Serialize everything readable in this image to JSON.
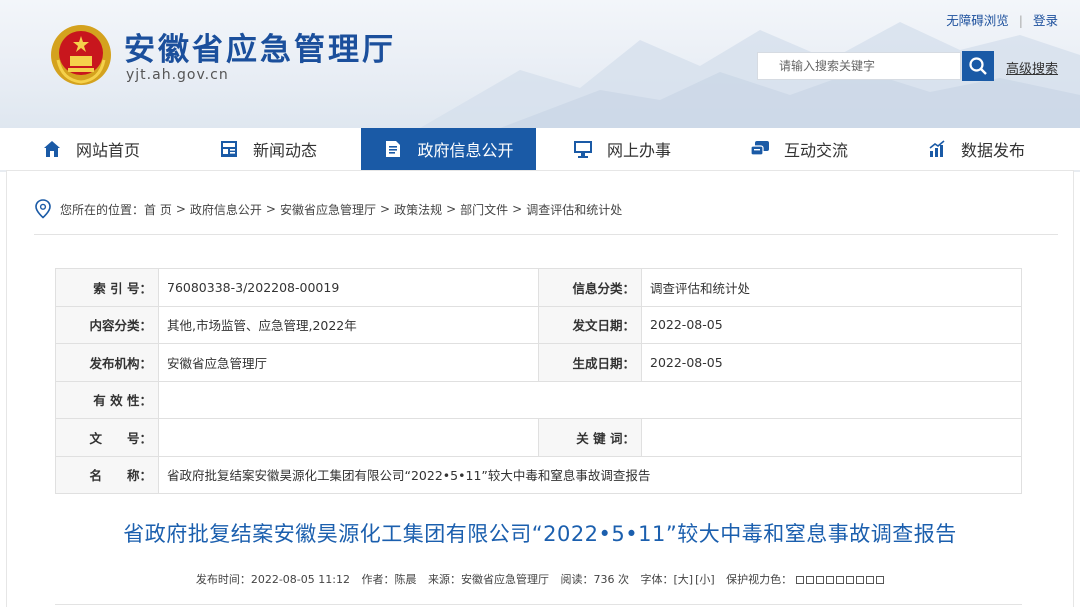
{
  "header": {
    "site_title": "安徽省应急管理厅",
    "site_domain": "yjt.ah.gov.cn",
    "accessibility_link": "无障碍浏览",
    "login_link": "登录",
    "search_placeholder": "请输入搜索关键字",
    "advanced_search": "高级搜索",
    "accent_color": "#1a5aa6"
  },
  "nav": {
    "items": [
      {
        "label": "网站首页",
        "icon": "home-icon"
      },
      {
        "label": "新闻动态",
        "icon": "news-icon"
      },
      {
        "label": "政府信息公开",
        "icon": "document-icon",
        "active": true
      },
      {
        "label": "网上办事",
        "icon": "monitor-icon"
      },
      {
        "label": "互动交流",
        "icon": "chat-icon"
      },
      {
        "label": "数据发布",
        "icon": "chart-icon"
      }
    ]
  },
  "breadcrumb": {
    "prefix": "您所在的位置：",
    "items": [
      "首 页",
      "政府信息公开",
      "安徽省应急管理厅",
      "政策法规",
      "部门文件",
      "调查评估和统计处"
    ]
  },
  "meta": {
    "index_label": "索 引 号：",
    "index_value": "76080338-3/202208-00019",
    "info_class_label": "信息分类：",
    "info_class_value": "调查评估和统计处",
    "content_class_label": "内容分类：",
    "content_class_value": "其他,市场监管、应急管理,2022年",
    "issue_date_label": "发文日期：",
    "issue_date_value": "2022-08-05",
    "publisher_label": "发布机构：",
    "publisher_value": "安徽省应急管理厅",
    "gen_date_label": "生成日期：",
    "gen_date_value": "2022-08-05",
    "validity_label": "有 效 性：",
    "validity_value": "",
    "doc_no_label": "文　　号：",
    "doc_no_value": "",
    "keywords_label": "关 键 词：",
    "keywords_value": "",
    "name_label": "名　　称：",
    "name_value": "省政府批复结案安徽昊源化工集团有限公司“2022•5•11”较大中毒和窒息事故调查报告"
  },
  "article": {
    "title": "省政府批复结案安徽昊源化工集团有限公司“2022•5•11”较大中毒和窒息事故调查报告",
    "publish_time": "发布时间：2022-08-05 11:12",
    "author": "作者：陈晨",
    "source": "来源：安徽省应急管理厅",
    "reads": "阅读：736 次",
    "font_size_label": "字体：",
    "font_large": "[大]",
    "font_small": "[小]",
    "eye_care_label": "保护视力色："
  }
}
